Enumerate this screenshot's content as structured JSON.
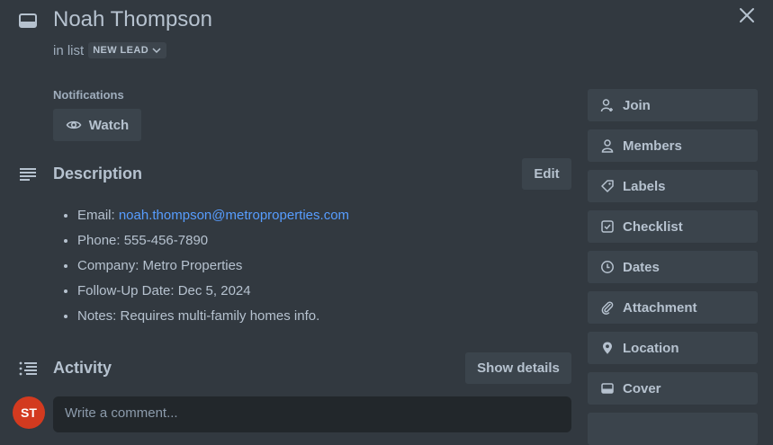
{
  "card": {
    "title": "Noah Thompson",
    "in_list_prefix": "in list",
    "list_name": "NEW LEAD"
  },
  "notifications": {
    "label": "Notifications",
    "watch_label": "Watch"
  },
  "description": {
    "title": "Description",
    "edit_label": "Edit",
    "items": [
      {
        "prefix": "Email: ",
        "link": "noah.thompson@metroproperties.com"
      },
      {
        "prefix": "Phone: 555-456-7890"
      },
      {
        "prefix": "Company: Metro Properties"
      },
      {
        "prefix": "Follow-Up Date: Dec 5, 2024"
      },
      {
        "prefix": "Notes: Requires multi-family homes info."
      }
    ]
  },
  "activity": {
    "title": "Activity",
    "show_details_label": "Show details",
    "avatar_initials": "ST",
    "comment_placeholder": "Write a comment..."
  },
  "sidebar": {
    "buttons": [
      {
        "label": "Join",
        "icon": "join-icon"
      },
      {
        "label": "Members",
        "icon": "members-icon"
      },
      {
        "label": "Labels",
        "icon": "labels-icon"
      },
      {
        "label": "Checklist",
        "icon": "checklist-icon"
      },
      {
        "label": "Dates",
        "icon": "clock-icon"
      },
      {
        "label": "Attachment",
        "icon": "paperclip-icon"
      },
      {
        "label": "Location",
        "icon": "location-pin-icon"
      },
      {
        "label": "Cover",
        "icon": "cover-icon"
      }
    ]
  },
  "colors": {
    "background": "#323940",
    "button": "#3b444c",
    "link": "#579dff",
    "avatar": "#d33a1f"
  }
}
